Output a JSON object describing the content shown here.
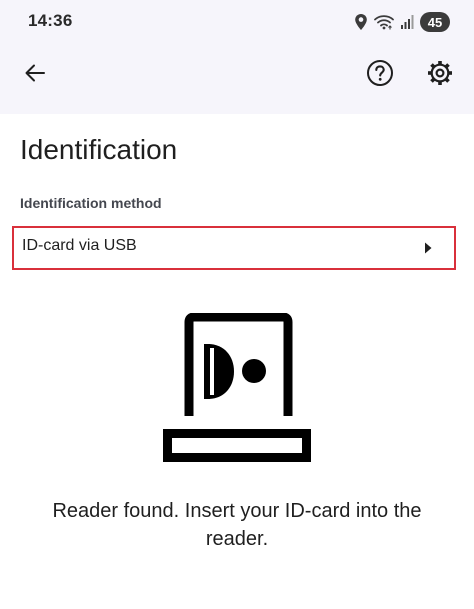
{
  "status_bar": {
    "time": "14:36",
    "battery_level": "45",
    "icons": [
      "location-icon",
      "wifi-icon",
      "signal-icon",
      "battery-icon"
    ]
  },
  "app_bar": {
    "back_icon": "arrow-left-icon",
    "help_icon": "help-circle-icon",
    "settings_icon": "gear-icon"
  },
  "page": {
    "title": "Identification",
    "method_label": "Identification method",
    "method_value": "ID-card via USB",
    "status_message": "Reader found. Insert your ID-card into the reader."
  },
  "colors": {
    "header_background": "#f6f5fb",
    "highlight_border": "#d9303b",
    "text": "#1f1f1f"
  }
}
